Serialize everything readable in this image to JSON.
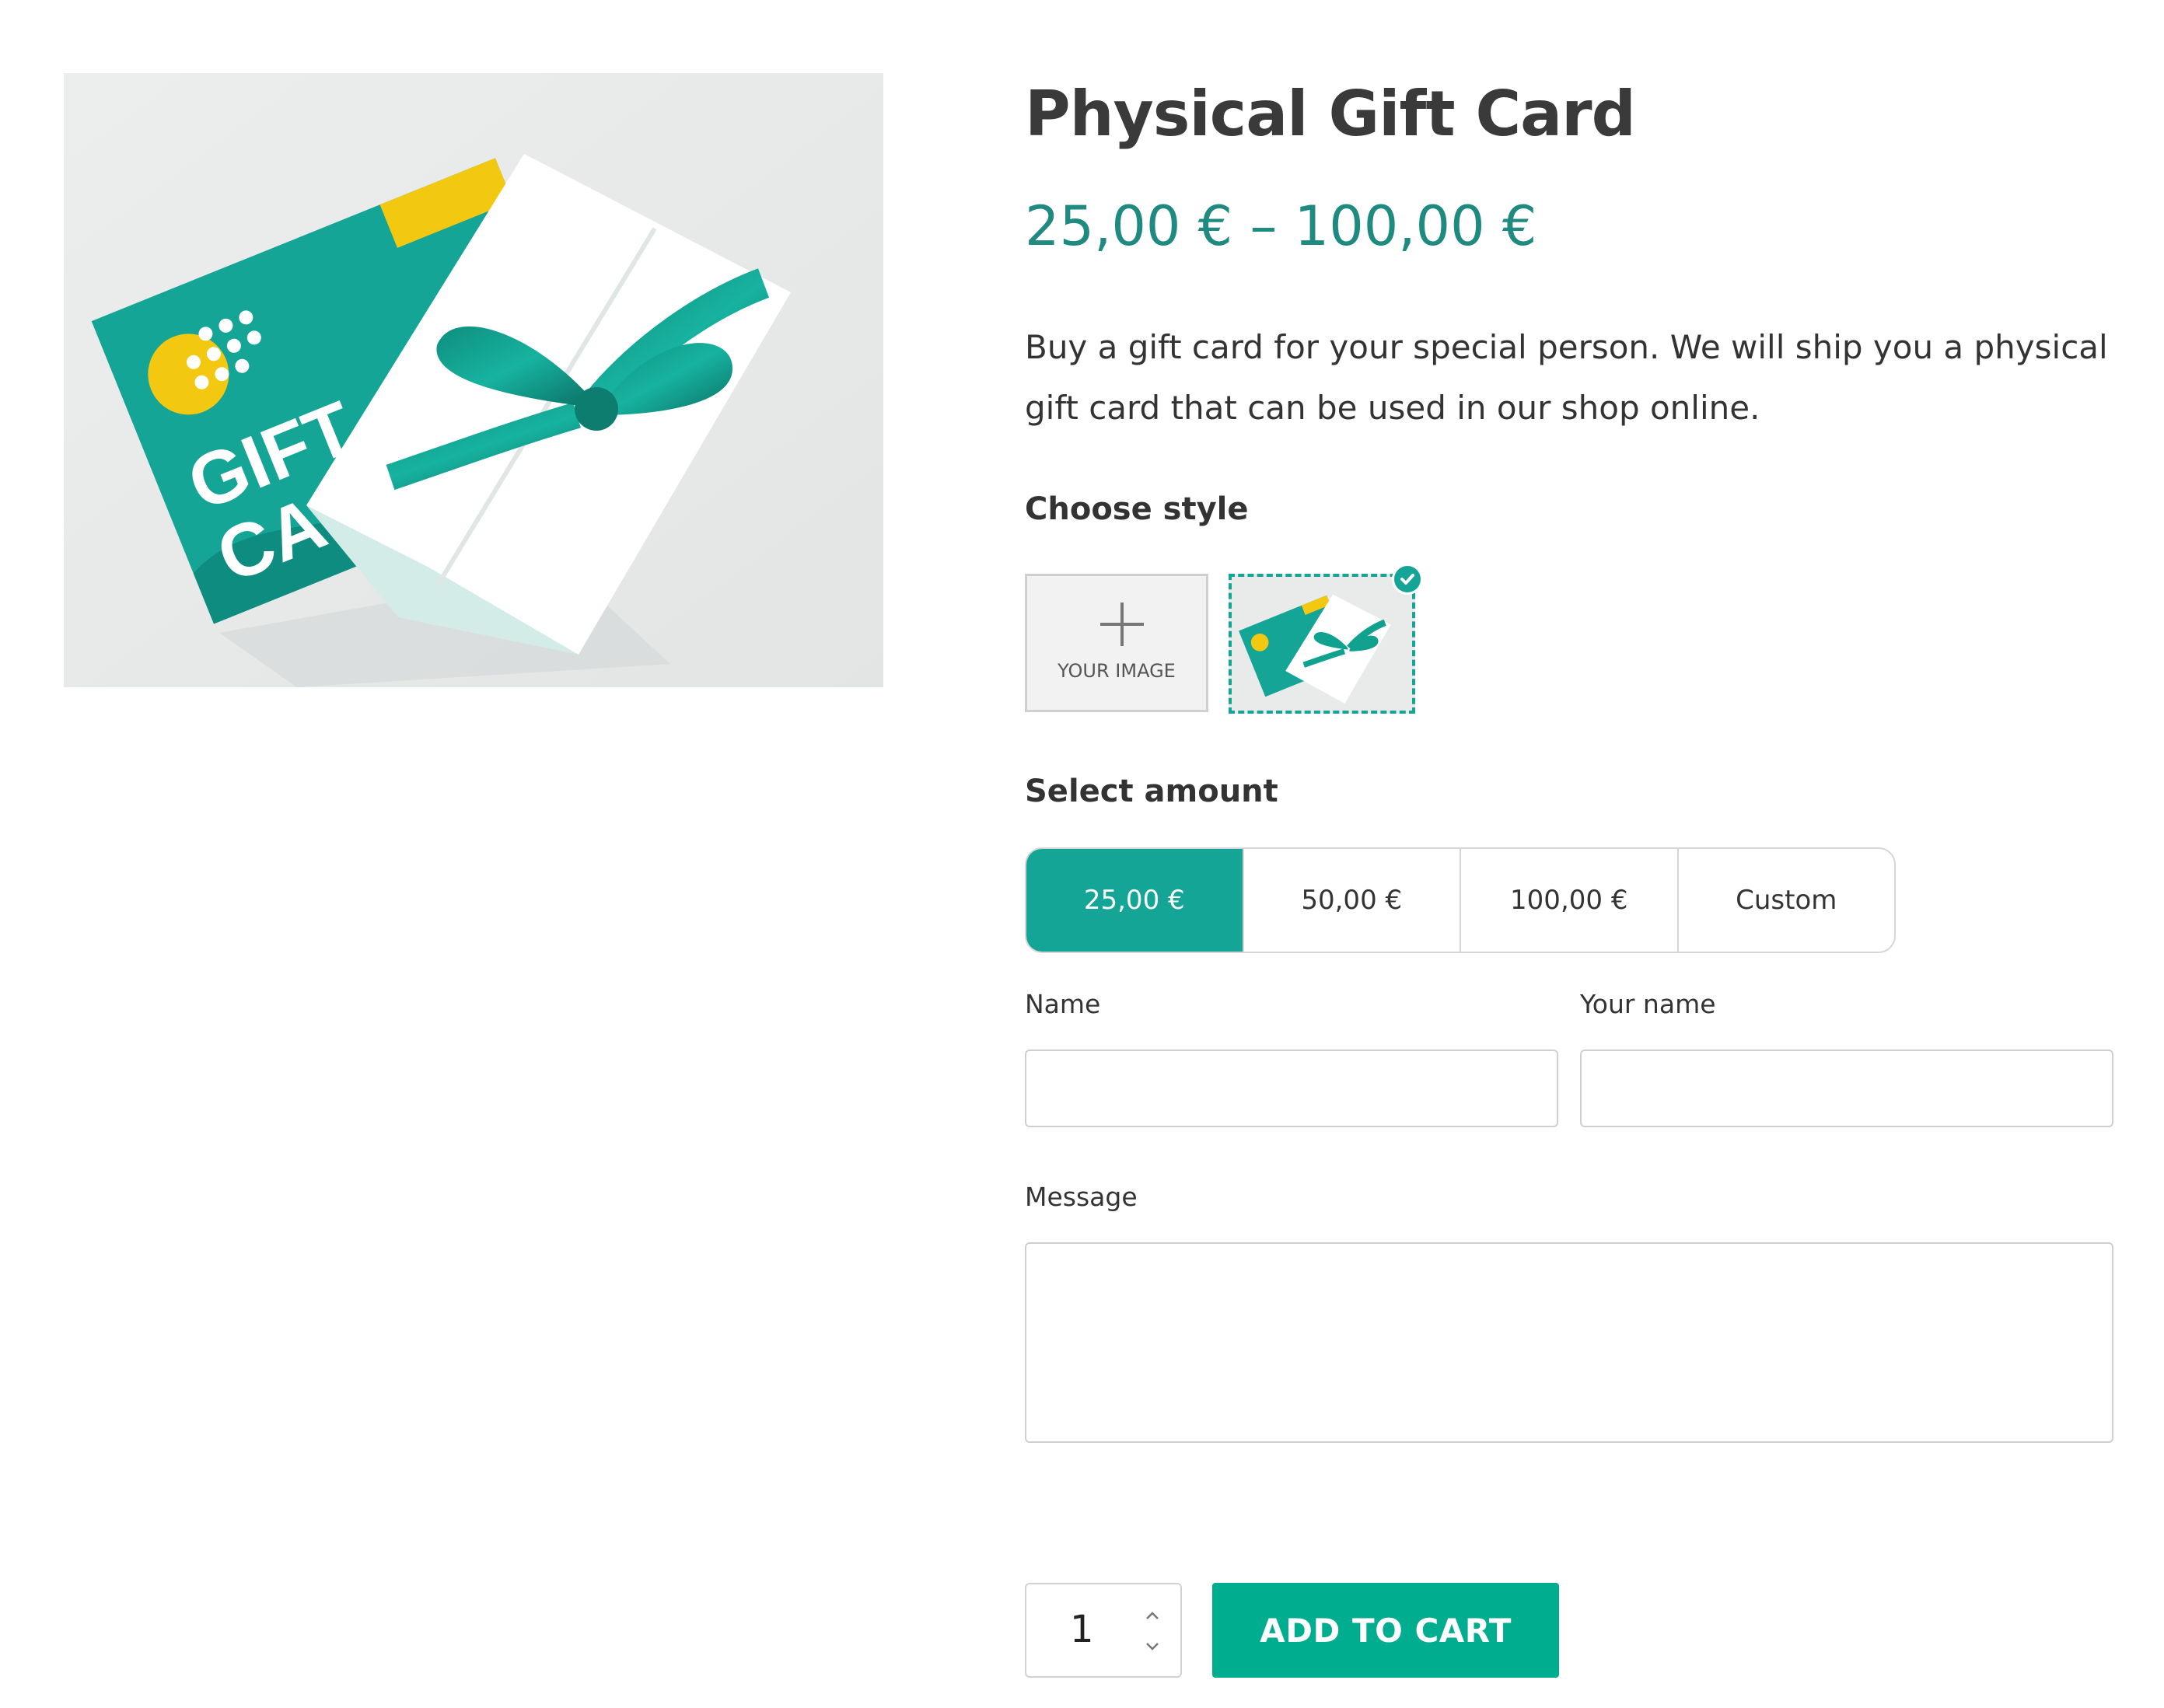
{
  "product": {
    "title": "Physical Gift Card",
    "price_range": "25,00 € – 100,00 €",
    "description": "Buy a gift card for your special person. We will ship you a physical gift card that can be used in our shop online.",
    "image_icon": "gift-card-photo",
    "image_text_lines": [
      "GIFT",
      "CARD"
    ]
  },
  "style": {
    "label": "Choose style",
    "upload_label": "YOUR IMAGE",
    "selected": "gift-card-photo"
  },
  "amount": {
    "label": "Select amount",
    "options": [
      "25,00 €",
      "50,00 €",
      "100,00 €",
      "Custom"
    ],
    "selected": "25,00 €"
  },
  "form": {
    "name_label": "Name",
    "your_name_label": "Your name",
    "message_label": "Message",
    "name_value": "",
    "your_name_value": "",
    "message_value": ""
  },
  "cart": {
    "quantity": "1",
    "button_label": "ADD TO CART"
  },
  "colors": {
    "accent": "#14a597",
    "price": "#1f8a80",
    "button": "#00ad8f",
    "card_yellow": "#f2c811"
  }
}
